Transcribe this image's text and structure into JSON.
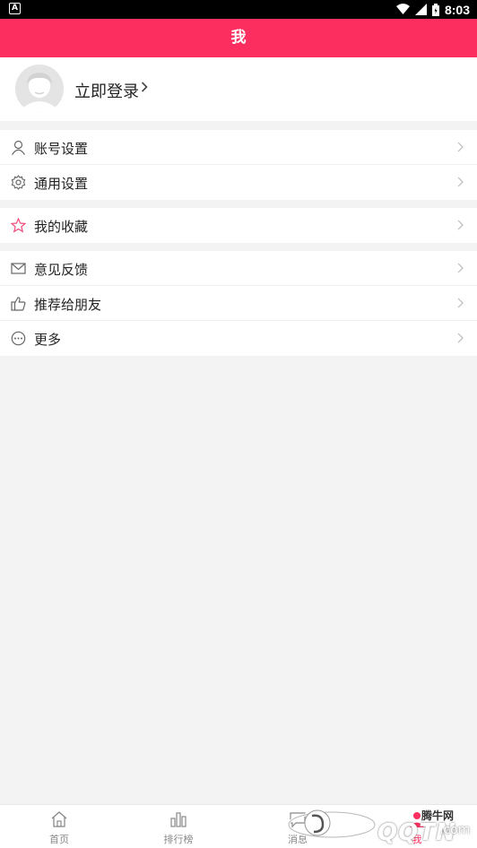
{
  "status_bar": {
    "time": "8:03",
    "app_badge": "A"
  },
  "header": {
    "title": "我"
  },
  "profile": {
    "login_label": "立即登录"
  },
  "groups": [
    [
      {
        "label": "账号设置",
        "icon": "user-icon"
      },
      {
        "label": "通用设置",
        "icon": "gear-icon"
      }
    ],
    [
      {
        "label": "我的收藏",
        "icon": "star-icon"
      }
    ],
    [
      {
        "label": "意见反馈",
        "icon": "mail-icon"
      },
      {
        "label": "推荐给朋友",
        "icon": "thumbs-up-icon"
      },
      {
        "label": "更多",
        "icon": "more-dots-icon"
      }
    ]
  ],
  "tabs": [
    {
      "label": "首页",
      "icon": "home-icon"
    },
    {
      "label": "排行榜",
      "icon": "bar-chart-icon"
    },
    {
      "label": "消息",
      "icon": "message-icon"
    },
    {
      "label": "我",
      "icon": "person-icon"
    }
  ],
  "watermark": {
    "logo_text": "QQTN",
    "site_name": "腾牛网",
    "suffix": ".com"
  },
  "colors": {
    "accent": "#fb2e5f",
    "background": "#f3f3f3",
    "star": "#f24a7a"
  }
}
